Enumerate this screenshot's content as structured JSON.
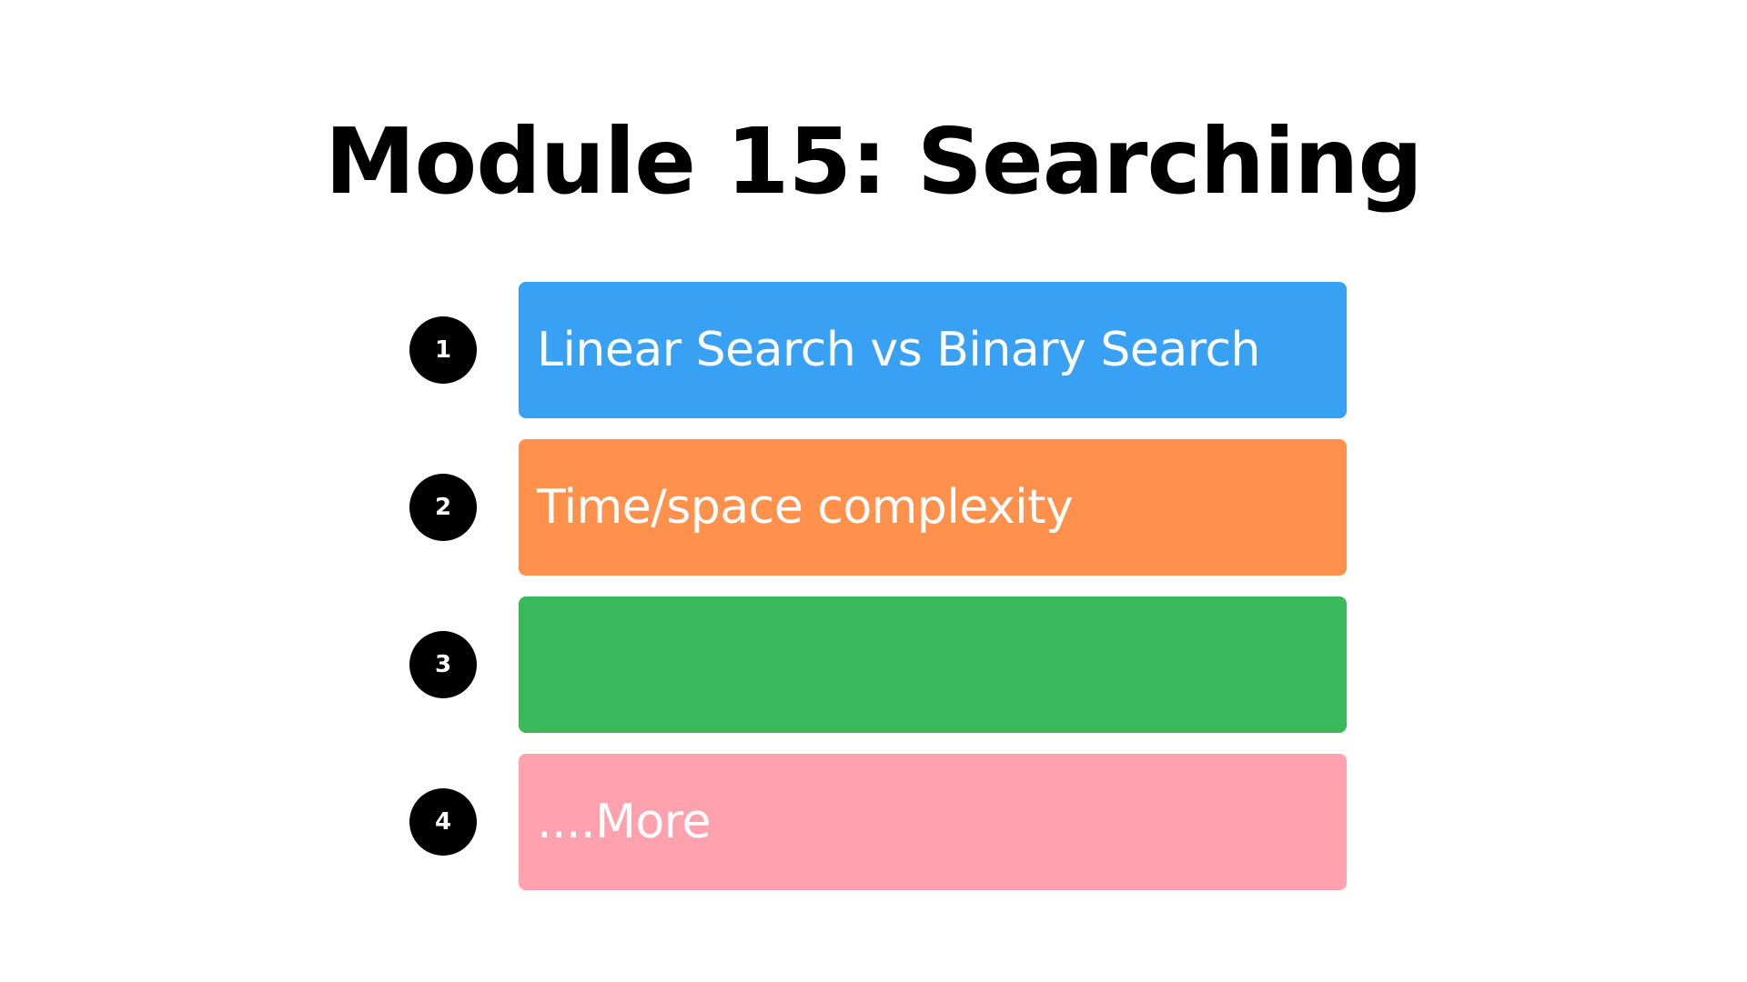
{
  "slide": {
    "title": "Module 15: Searching",
    "items": [
      {
        "number": "1",
        "label": "Linear Search vs Binary Search",
        "color": "#38A1F3"
      },
      {
        "number": "2",
        "label": "Time/space complexity",
        "color": "#FF914D"
      },
      {
        "number": "3",
        "label": "",
        "color": "#3AB85C"
      },
      {
        "number": "4",
        "label": "....More",
        "color": "#FFA2AE"
      }
    ]
  }
}
